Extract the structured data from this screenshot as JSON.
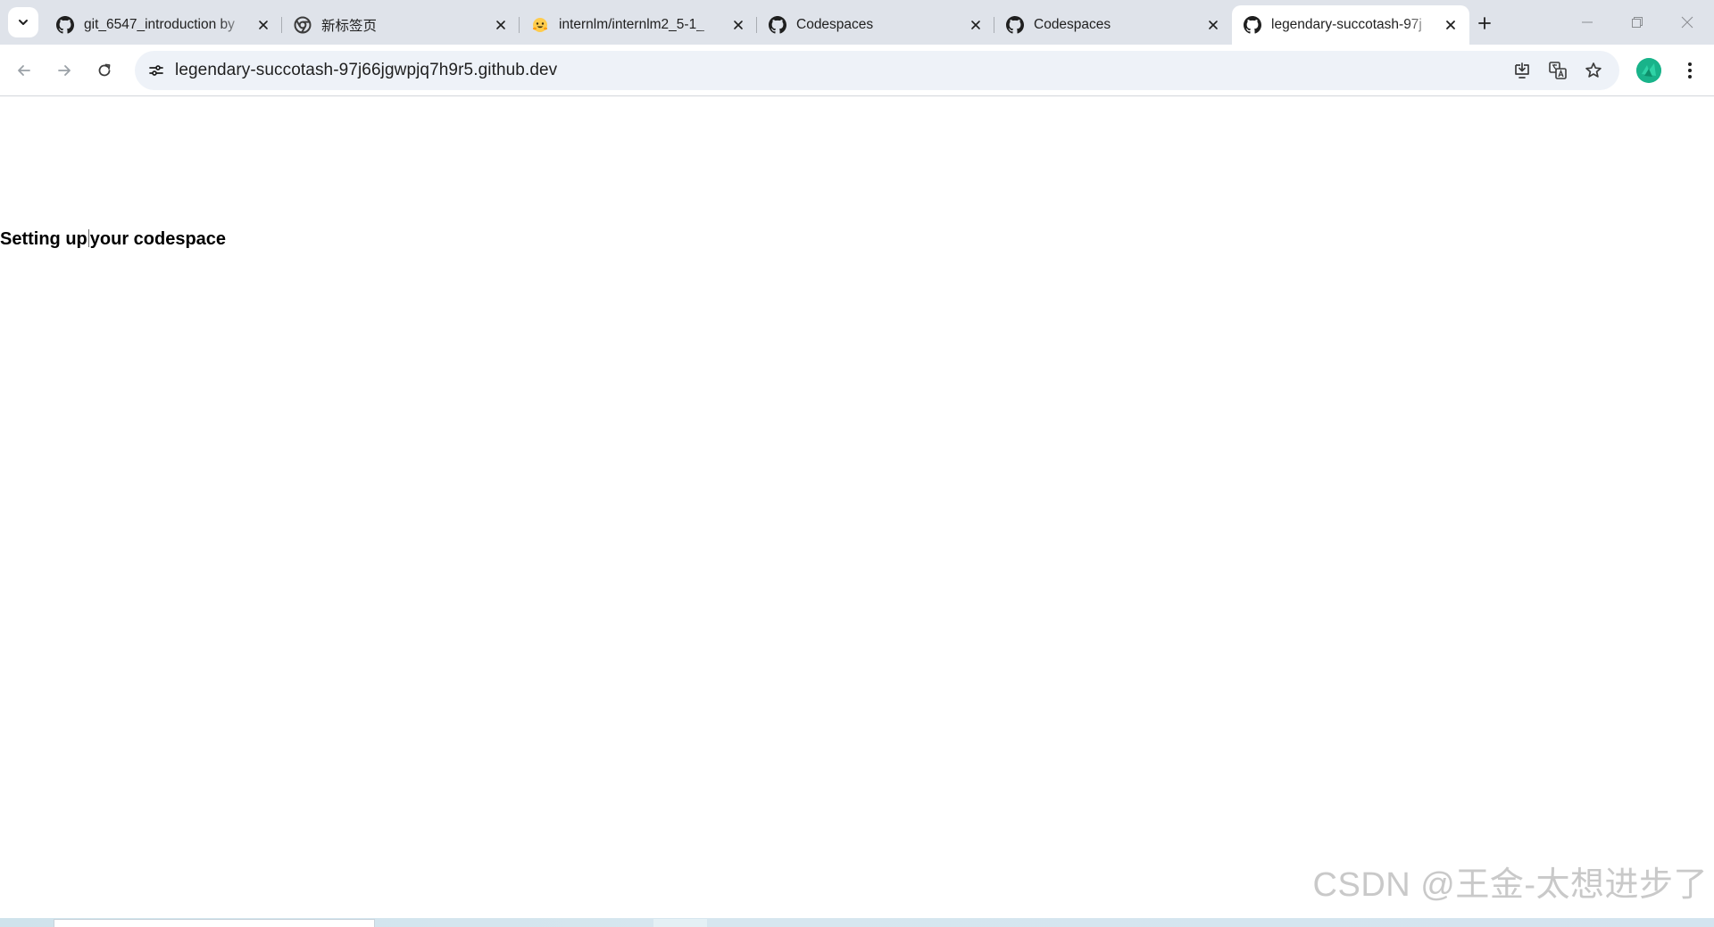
{
  "browser": {
    "tabs": [
      {
        "title": "git_6547_introduction by",
        "icon": "github-icon",
        "active": false
      },
      {
        "title": "新标签页",
        "icon": "chrome-icon",
        "active": false
      },
      {
        "title": "internlm/internlm2_5-1_",
        "icon": "huggingface-icon",
        "active": false
      },
      {
        "title": "Codespaces",
        "icon": "github-icon",
        "active": false
      },
      {
        "title": "Codespaces",
        "icon": "github-icon",
        "active": false
      },
      {
        "title": "legendary-succotash-97j",
        "icon": "github-icon",
        "active": true
      }
    ],
    "address_bar": {
      "url": "legendary-succotash-97j66jgwpjq7h9r5.github.dev"
    },
    "colors": {
      "tabstrip_bg": "#dfe3ea",
      "omnibox_bg": "#eef2f8",
      "profile_bg": "#1fb98a"
    }
  },
  "page": {
    "status_text_before_caret": "Setting up",
    "status_text_after_caret": "your codespace",
    "watermark": "CSDN @王金-太想进步了"
  }
}
